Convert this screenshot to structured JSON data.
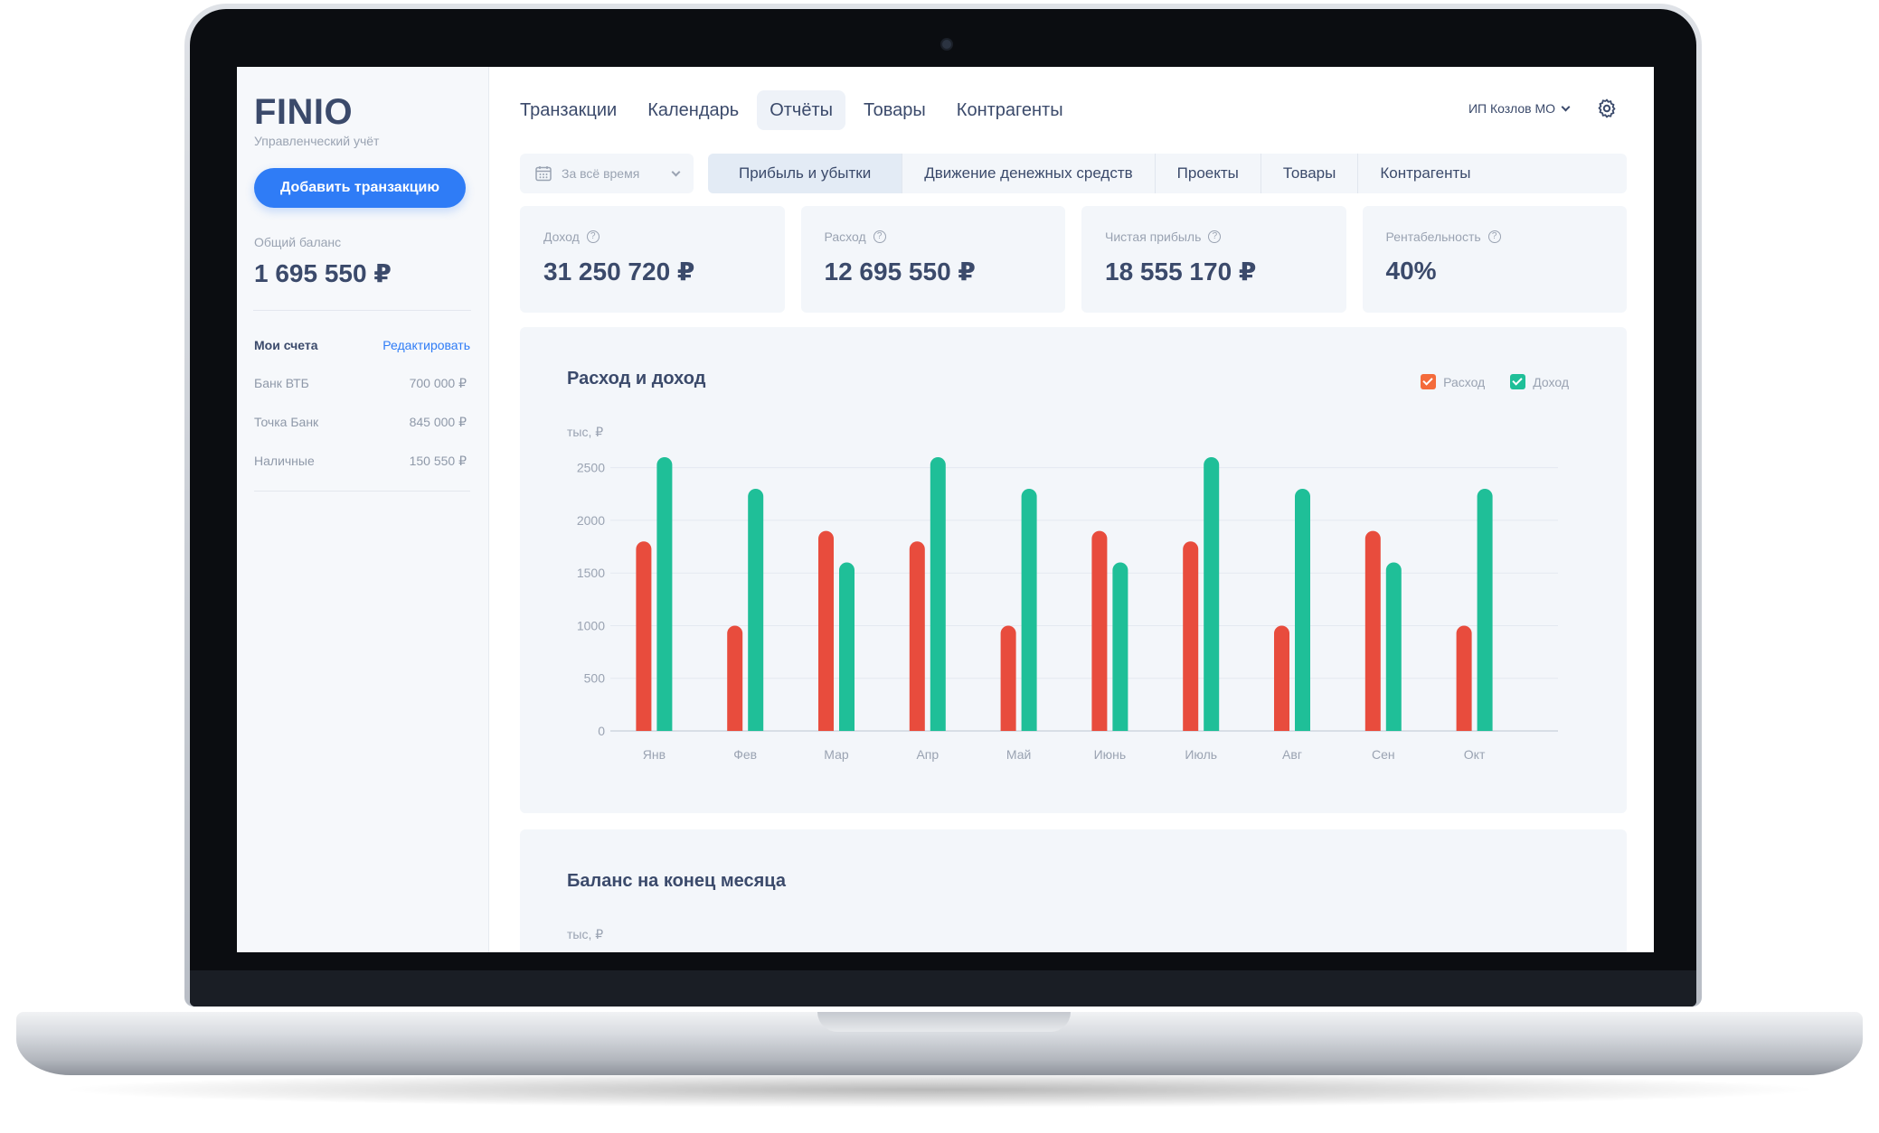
{
  "app": {
    "logo": "FINIO",
    "subtitle": "Управленческий учёт",
    "add_button": "Добавить транзакцию"
  },
  "balance": {
    "label": "Общий баланс",
    "value": "1 695 550 ₽"
  },
  "accounts": {
    "title": "Мои счета",
    "edit": "Редактировать",
    "items": [
      {
        "name": "Банк ВТБ",
        "amount": "700 000 ₽"
      },
      {
        "name": "Точка Банк",
        "amount": "845 000 ₽"
      },
      {
        "name": "Наличные",
        "amount": "150 550 ₽"
      }
    ]
  },
  "nav": {
    "items": [
      "Транзакции",
      "Календарь",
      "Отчёты",
      "Товары",
      "Контрагенты"
    ],
    "active": "Отчёты",
    "company": "ИП Козлов МО"
  },
  "filters": {
    "period": "За всё время",
    "tabs": [
      "Прибыль и убытки",
      "Движение денежных средств",
      "Проекты",
      "Товары",
      "Контрагенты"
    ],
    "active_tab": "Прибыль и убытки"
  },
  "kpis": [
    {
      "label": "Доход",
      "value": "31 250 720 ₽"
    },
    {
      "label": "Расход",
      "value": "12 695 550 ₽"
    },
    {
      "label": "Чистая прибыль",
      "value": "18 555 170 ₽"
    },
    {
      "label": "Рентабельность",
      "value": "40%"
    }
  ],
  "colors": {
    "expense": "#e84c3d",
    "income": "#1fbf98",
    "accent": "#2f7cf6",
    "expense_checkbox": "#f46b3b"
  },
  "chart_data": {
    "type": "bar",
    "title": "Расход и доход",
    "ylabel": "тыс, ₽",
    "categories": [
      "Янв",
      "Фев",
      "Мар",
      "Апр",
      "Май",
      "Июнь",
      "Июль",
      "Авг",
      "Сен",
      "Окт"
    ],
    "series": [
      {
        "name": "Расход",
        "values": [
          1800,
          1000,
          1900,
          1800,
          1000,
          1900,
          1800,
          1000,
          1900,
          1000
        ]
      },
      {
        "name": "Доход",
        "values": [
          2600,
          2300,
          1600,
          2600,
          2300,
          1600,
          2600,
          2300,
          1600,
          2300
        ]
      }
    ],
    "yticks": [
      0,
      500,
      1000,
      1500,
      2000,
      2500
    ],
    "ylim": [
      0,
      2600
    ],
    "grid": true,
    "legend": "top-right"
  },
  "balance_chart": {
    "title": "Баланс на конец месяца",
    "ylabel": "тыс, ₽"
  }
}
